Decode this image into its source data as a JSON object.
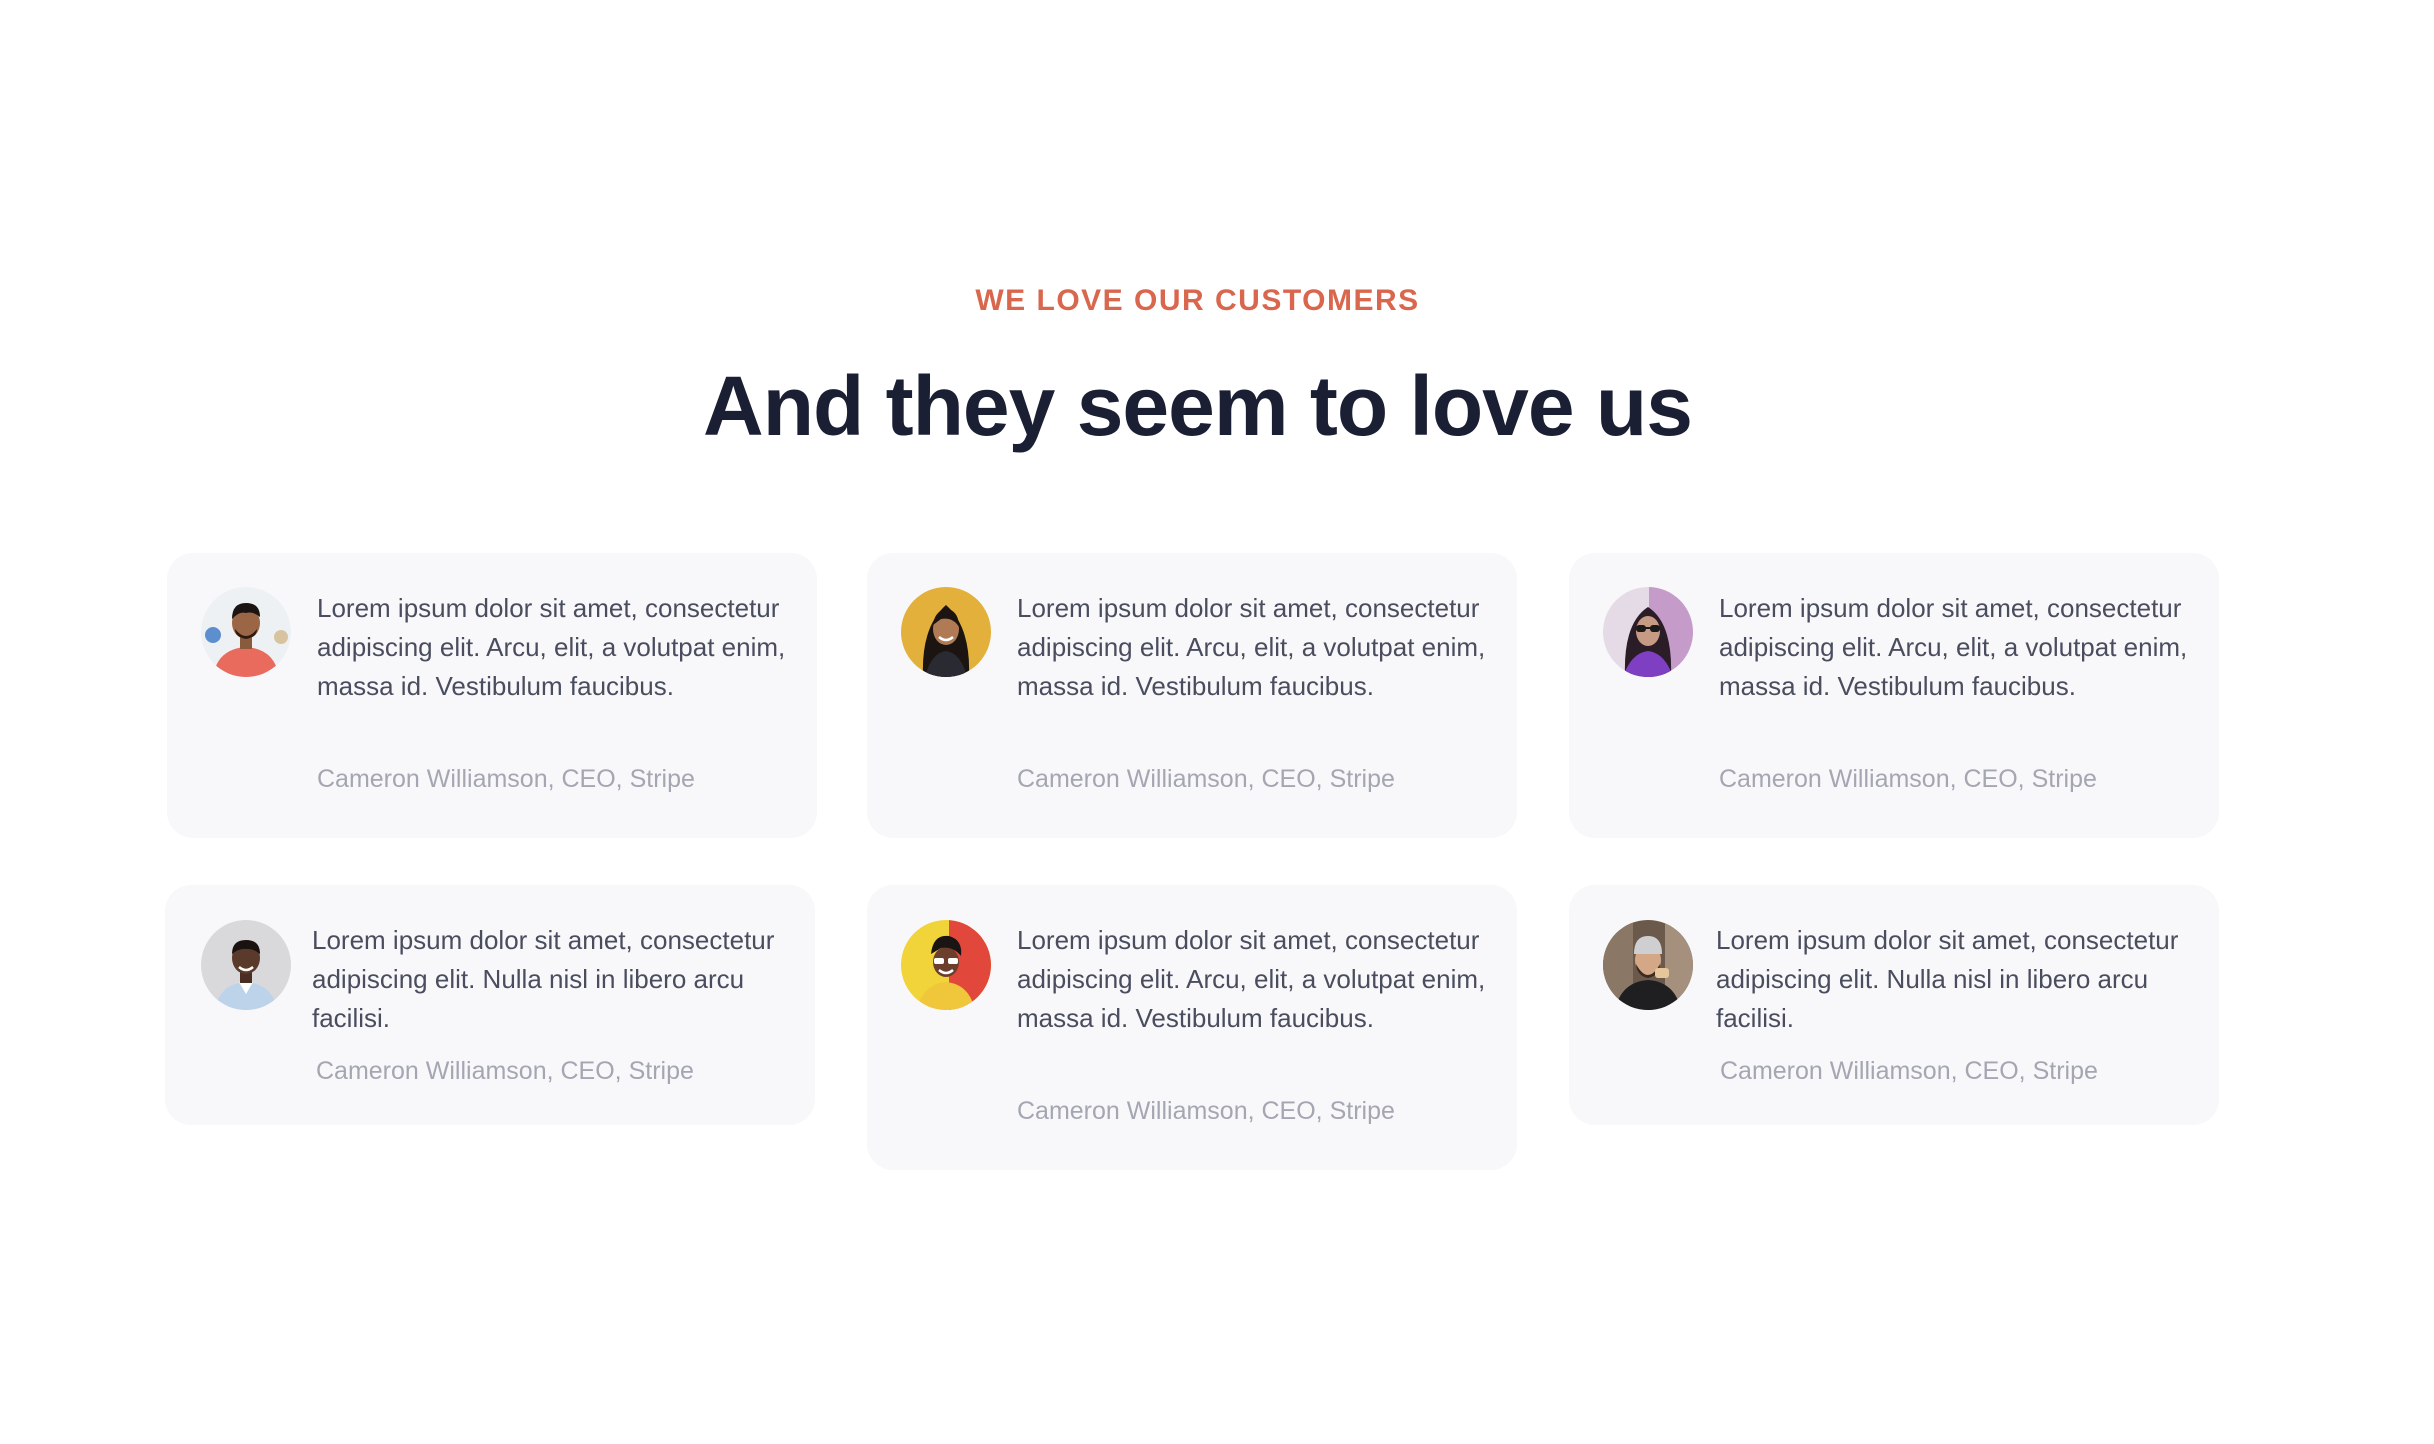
{
  "section": {
    "eyebrow": "WE LOVE OUR CUSTOMERS",
    "headline": "And they seem to love us"
  },
  "colors": {
    "accent": "#d9674e",
    "headline": "#1b1f33",
    "card_background": "#f8f8fb",
    "quote_text": "#4a4d5e",
    "author_text": "#a4a6b2"
  },
  "testimonials": [
    {
      "quote": "Lorem ipsum dolor sit amet, consectetur adipiscing elit. Arcu, elit, a volutpat enim, massa id. Vestibulum faucibus.",
      "author": "Cameron Williamson, CEO, Stripe",
      "avatar": "man-red-shirt-photo"
    },
    {
      "quote": "Lorem ipsum dolor sit amet, consectetur adipiscing elit. Arcu, elit, a volutpat enim, massa id. Vestibulum faucibus.",
      "author": "Cameron Williamson, CEO, Stripe",
      "avatar": "woman-yellow-background-photo"
    },
    {
      "quote": "Lorem ipsum dolor sit amet, consectetur adipiscing elit. Arcu, elit, a volutpat enim, massa id. Vestibulum faucibus.",
      "author": "Cameron Williamson, CEO, Stripe",
      "avatar": "woman-purple-sunglasses-photo"
    },
    {
      "quote": "Lorem ipsum dolor sit amet, consectetur adipiscing elit. Nulla nisl in libero arcu facilisi.",
      "author": "Cameron Williamson, CEO, Stripe",
      "avatar": "man-grey-background-photo"
    },
    {
      "quote": "Lorem ipsum dolor sit amet, consectetur adipiscing elit. Arcu, elit, a volutpat enim, massa id. Vestibulum faucibus.",
      "author": "Cameron Williamson, CEO, Stripe",
      "avatar": "woman-yellow-red-background-photo"
    },
    {
      "quote": "Lorem ipsum dolor sit amet, consectetur adipiscing elit. Nulla nisl in libero arcu facilisi.",
      "author": "Cameron Williamson, CEO, Stripe",
      "avatar": "man-beanie-beard-photo"
    }
  ]
}
